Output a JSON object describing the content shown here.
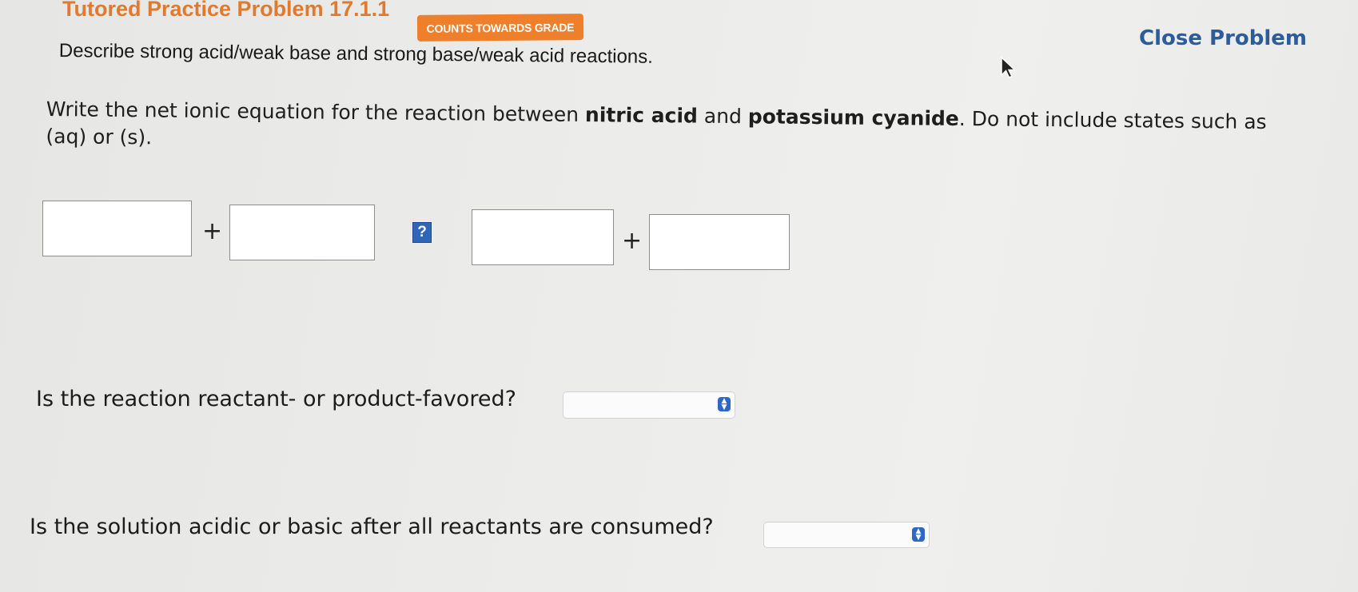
{
  "header": {
    "title": "Tutored Practice Problem 17.1.1",
    "badge": "COUNTS TOWARDS GRADE",
    "close_label": "Close Problem"
  },
  "problem": {
    "description": "Describe strong acid/weak base and strong base/weak acid reactions.",
    "instruction_part1": "Write the net ionic equation for the reaction between ",
    "reactant_a": "nitric acid",
    "instruction_and": " and ",
    "reactant_b": "potassium cyanide",
    "instruction_part2": ". Do not include states such as (aq) or (s)."
  },
  "equation": {
    "plus_1": "+",
    "plus_2": "+",
    "arrow_help": "?",
    "inputs": [
      "",
      "",
      "",
      ""
    ]
  },
  "questions": {
    "q1": "Is the reaction reactant- or product-favored?",
    "q1_value": "",
    "q2": "Is the solution acidic or basic after all reactants are consumed?",
    "q2_value": ""
  },
  "icons": {
    "select_chevron": "chevron-updown-icon",
    "cursor": "mouse-pointer-icon"
  }
}
